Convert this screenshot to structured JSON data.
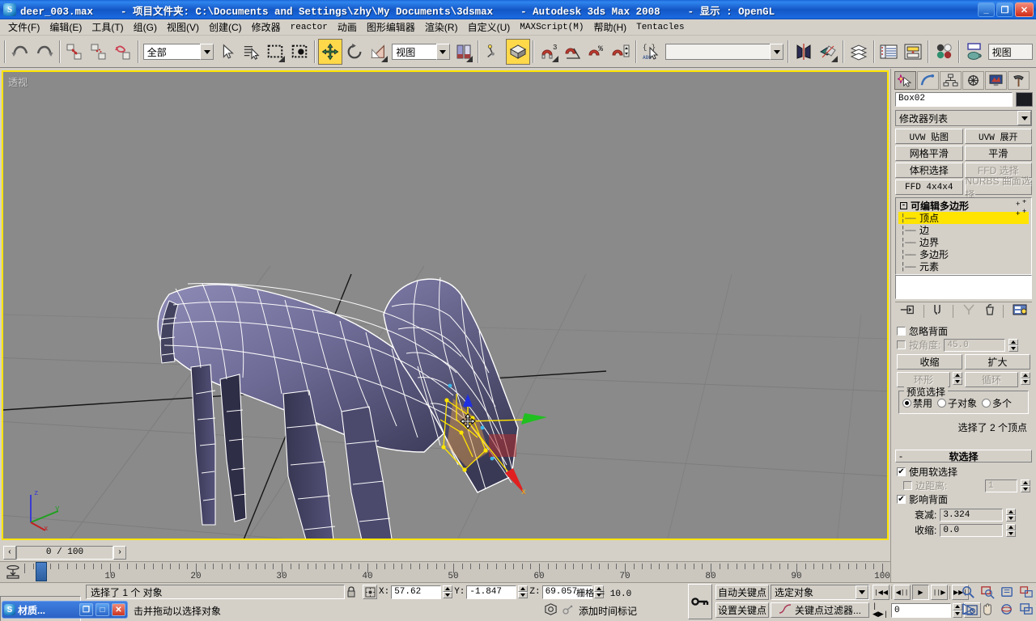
{
  "titlebar": {
    "file_name": "deer_003.max",
    "project_label": "- 项目文件夹: C:\\Documents and Settings\\zhy\\My Documents\\3dsmax",
    "app_label": "- Autodesk 3ds Max 2008",
    "display_label": "- 显示 : OpenGL",
    "minimize": "_",
    "maximize": "❐",
    "close": "✕",
    "app_icon": "3ds-max-icon"
  },
  "menubar": {
    "items": [
      {
        "label": "文件(F)",
        "mono": false
      },
      {
        "label": "编辑(E)",
        "mono": false
      },
      {
        "label": "工具(T)",
        "mono": false
      },
      {
        "label": "组(G)",
        "mono": false
      },
      {
        "label": "视图(V)",
        "mono": false
      },
      {
        "label": "创建(C)",
        "mono": false
      },
      {
        "label": "修改器",
        "mono": false
      },
      {
        "label": "reactor",
        "mono": true
      },
      {
        "label": "动画",
        "mono": false
      },
      {
        "label": "图形编辑器",
        "mono": false
      },
      {
        "label": "渲染(R)",
        "mono": false
      },
      {
        "label": "自定义(U)",
        "mono": false
      },
      {
        "label": "MAXScript(M)",
        "mono": true
      },
      {
        "label": "帮助(H)",
        "mono": false
      },
      {
        "label": "Tentacles",
        "mono": true
      }
    ]
  },
  "toolbar": {
    "selection_filter_value": "全部",
    "reference_coord_value": "视图",
    "named_selection_set_value": "",
    "buttons": [
      {
        "name": "undo-button",
        "title": "撤消"
      },
      {
        "name": "redo-button",
        "title": "重做"
      },
      {
        "name": "select-and-link-button",
        "title": "选择并链接"
      },
      {
        "name": "unlink-selection-button",
        "title": "断开当前选择链接"
      },
      {
        "name": "bind-to-space-warp-button",
        "title": "绑定到空间扭曲"
      },
      {
        "name": "select-object-button",
        "title": "选择对象"
      },
      {
        "name": "select-by-name-button",
        "title": "按名称选择"
      },
      {
        "name": "rectangular-selection-region-button",
        "title": "矩形选择区域"
      },
      {
        "name": "window-crossing-toggle-button",
        "title": "窗口/交叉"
      },
      {
        "name": "select-and-move-button",
        "title": "选择并移动"
      },
      {
        "name": "select-and-rotate-button",
        "title": "选择并旋转"
      },
      {
        "name": "select-and-scale-button",
        "title": "选择并均匀缩放"
      },
      {
        "name": "use-center-flyout-button",
        "title": "使用轴点中心"
      },
      {
        "name": "select-and-manipulate-button",
        "title": "选择并操纵"
      },
      {
        "name": "snaps-toggle-button",
        "title": "捕捉开关"
      },
      {
        "name": "angle-snap-toggle-button",
        "title": "角度捕捉切换"
      },
      {
        "name": "percent-snap-toggle-button",
        "title": "百分比捕捉切换"
      },
      {
        "name": "spinner-snap-toggle-button",
        "title": "微调器捕捉切换"
      },
      {
        "name": "edit-named-selection-sets-button",
        "title": "编辑命名选择集"
      },
      {
        "name": "mirror-button",
        "title": "镜像"
      },
      {
        "name": "align-button",
        "title": "对齐"
      },
      {
        "name": "layer-manager-button",
        "title": "层管理器"
      },
      {
        "name": "curve-editor-button",
        "title": "曲线编辑器"
      },
      {
        "name": "schematic-view-button",
        "title": "图解视图"
      },
      {
        "name": "material-editor-button",
        "title": "材质编辑器"
      },
      {
        "name": "render-scene-dialog-button",
        "title": "渲染场景对话框"
      }
    ],
    "render_preset_value": "视图"
  },
  "viewport": {
    "label": "透视",
    "background_color": "#8a8a8a",
    "active_border_color": "#ffe400",
    "mesh_color": "#6d6a93",
    "wire_color": "#ffffff",
    "selected_subobject_color": "#ff4040",
    "axis_tripod": {
      "x": "x",
      "y": "y",
      "z": "z"
    },
    "gizmo": {
      "x_axis_color": "#e02020",
      "y_axis_color": "#20c020",
      "z_axis_color": "#2030e0"
    }
  },
  "command_panel": {
    "tabs": [
      {
        "name": "create-tab",
        "icon": "star-arrow-icon",
        "selected": true
      },
      {
        "name": "modify-tab",
        "icon": "curve-icon",
        "selected": false
      },
      {
        "name": "hierarchy-tab",
        "icon": "hierarchy-icon",
        "selected": false
      },
      {
        "name": "motion-tab",
        "icon": "wheel-icon",
        "selected": false
      },
      {
        "name": "display-tab",
        "icon": "monitor-icon",
        "selected": false
      },
      {
        "name": "utilities-tab",
        "icon": "hammer-icon",
        "selected": false
      }
    ],
    "object_name": "Box02",
    "object_color": "#1b1b22",
    "modifier_list_label": "修改器列表",
    "modifier_buttons": [
      {
        "label": "UVW 贴图",
        "mono": true,
        "disabled": false
      },
      {
        "label": "UVW 展开",
        "mono": true,
        "disabled": false
      },
      {
        "label": "网格平滑",
        "mono": false,
        "disabled": false
      },
      {
        "label": "平滑",
        "mono": false,
        "disabled": false
      },
      {
        "label": "体积选择",
        "mono": false,
        "disabled": false
      },
      {
        "label": "FFD 选择",
        "mono": false,
        "disabled": true
      },
      {
        "label": "FFD 4x4x4",
        "mono": true,
        "disabled": false
      },
      {
        "label": "NURBS 曲面选择",
        "mono": false,
        "disabled": true
      }
    ],
    "stack": {
      "root": "可编辑多边形",
      "items": [
        {
          "label": "顶点",
          "selected": true
        },
        {
          "label": "边",
          "selected": false
        },
        {
          "label": "边界",
          "selected": false
        },
        {
          "label": "多边形",
          "selected": false
        },
        {
          "label": "元素",
          "selected": false
        }
      ],
      "highlight_color": "#ffe400"
    },
    "stack_tools": [
      {
        "name": "pin-stack-button",
        "icon": "pin-icon"
      },
      {
        "name": "show-end-result-button",
        "icon": "end-result-icon"
      },
      {
        "name": "make-unique-button",
        "icon": "make-unique-icon"
      },
      {
        "name": "remove-modifier-button",
        "icon": "trash-icon"
      },
      {
        "name": "configure-modifier-sets-button",
        "icon": "config-icon"
      }
    ],
    "selection_rollout": {
      "ignore_backfacing": {
        "label": "忽略背面",
        "checked": false
      },
      "by_angle": {
        "label": "按角度:",
        "checked": false,
        "value": "45.0",
        "disabled": true
      },
      "shrink_button": "收缩",
      "grow_button": "扩大",
      "ring_button": "环形",
      "loop_button": "循环",
      "preview_group_label": "预览选择",
      "preview_options": [
        {
          "label": "禁用",
          "selected": true
        },
        {
          "label": "子对象",
          "selected": false
        },
        {
          "label": "多个",
          "selected": false
        }
      ],
      "status_text": "选择了 2 个顶点"
    },
    "soft_selection": {
      "title": "软选择",
      "collapse_glyph": "-",
      "use_soft_selection": {
        "label": "使用软选择",
        "checked": true
      },
      "edge_distance": {
        "label": "边距离:",
        "checked": false,
        "value": "1",
        "disabled": true
      },
      "affect_backfacing": {
        "label": "影响背面",
        "checked": true
      },
      "falloff": {
        "label": "衰减:",
        "value": "3.324"
      },
      "pinch": {
        "label": "收缩:",
        "value": "0.0"
      }
    }
  },
  "time_slider": {
    "prev_glyph": "‹",
    "next_glyph": "›",
    "current": "0 / 100",
    "track_start": 0,
    "track_end": 100,
    "major_ticks": [
      10,
      20,
      30,
      40,
      50,
      60,
      70,
      80,
      90,
      100
    ]
  },
  "status_bar": {
    "material_minibar": {
      "title": "材质...",
      "restore": "❐",
      "maximize": "□",
      "close": "✕",
      "icon": "material-editor-icon"
    },
    "prompt_line": "选择了 1 个 对象",
    "hint_line": "击并拖动以选择对象",
    "lock_icon": "lock-icon",
    "transform_type_in_icon": "absolute-mode-icon",
    "coords": [
      {
        "axis": "X:",
        "value": "57.62"
      },
      {
        "axis": "Y:",
        "value": "-1.847"
      },
      {
        "axis": "Z:",
        "value": "69.057"
      }
    ],
    "grid_text": "栅格 = 10.0",
    "add_time_tag": "添加时间标记",
    "key_mode_icon": "key-icon",
    "auto_key_button": "自动关键点",
    "set_key_button": "设置关键点",
    "selection_combo_value": "选定对象",
    "key_filters_button": "关键点过滤器...",
    "frame_value": "0",
    "playback_buttons": [
      {
        "name": "goto-start-button",
        "glyph": "|◀◀"
      },
      {
        "name": "previous-frame-button",
        "glyph": "◀||"
      },
      {
        "name": "play-animation-button",
        "glyph": "▶",
        "selected": true
      },
      {
        "name": "next-frame-button",
        "glyph": "||▶"
      },
      {
        "name": "goto-end-button",
        "glyph": "▶▶|"
      }
    ],
    "key_mode_toggle": {
      "name": "key-mode-toggle-button",
      "glyph": "|◀▶|"
    },
    "viewport_nav_buttons": [
      {
        "name": "zoom-button",
        "icon": "magnifier-icon"
      },
      {
        "name": "zoom-all-button",
        "icon": "zoom-all-icon"
      },
      {
        "name": "zoom-extents-button",
        "icon": "zoom-extents-icon"
      },
      {
        "name": "zoom-extents-all-button",
        "icon": "zoom-extents-all-icon"
      },
      {
        "name": "field-of-view-button",
        "icon": "fov-icon"
      },
      {
        "name": "pan-view-button",
        "icon": "hand-icon"
      },
      {
        "name": "arc-rotate-button",
        "icon": "arc-rotate-icon"
      },
      {
        "name": "maximize-viewport-toggle-button",
        "icon": "maximize-viewport-icon"
      }
    ],
    "time-config-icon": "time-configuration-icon"
  }
}
